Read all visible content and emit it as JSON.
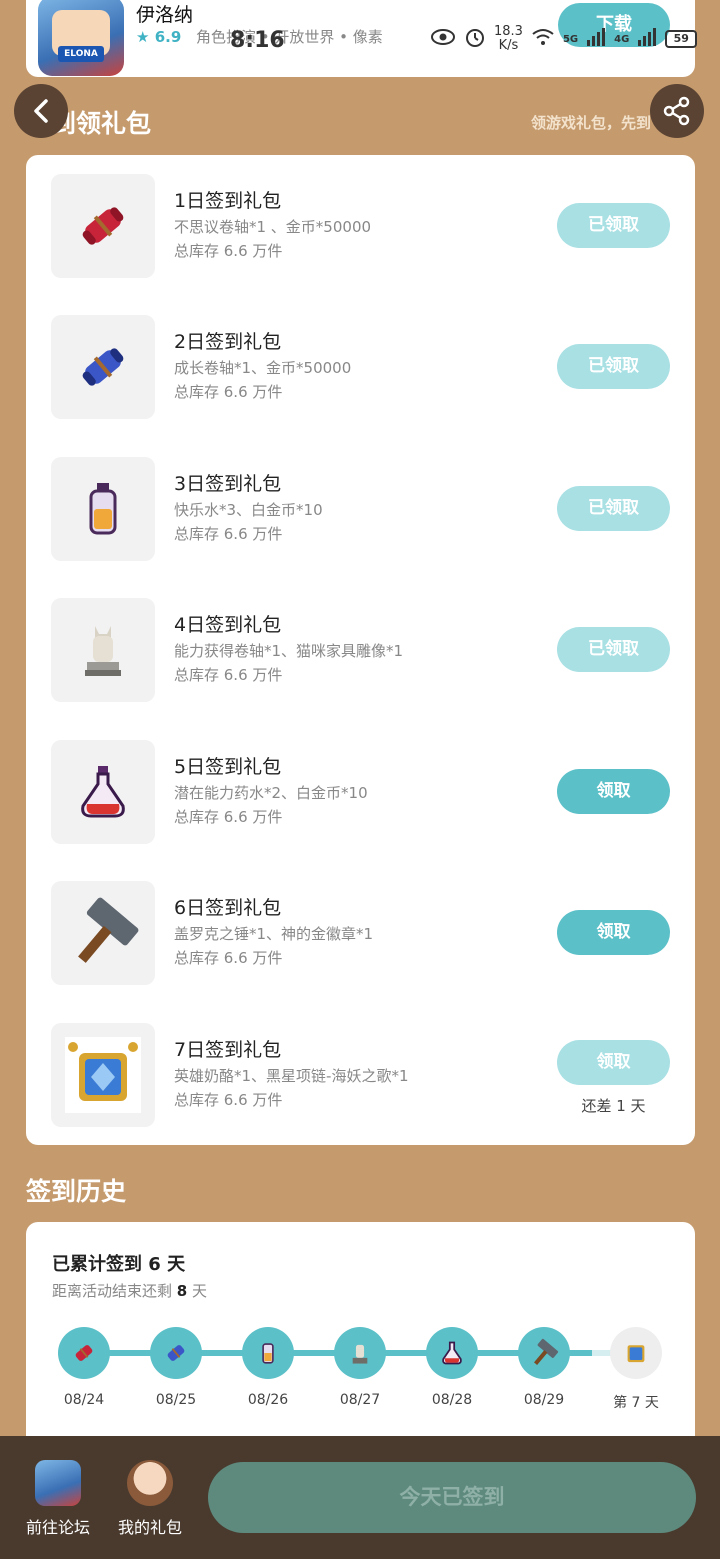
{
  "status_bar": {
    "time": "8:16",
    "net_speed": "18.3",
    "net_unit": "K/s",
    "network_1": "5G",
    "network_2": "4G",
    "battery": "59"
  },
  "game": {
    "name": "伊洛纳",
    "rating": "6.9",
    "tags": "角色扮演 • 开放世界 • 像素",
    "download_label": "下载",
    "icon_text": "ELONA"
  },
  "header": {
    "title": "签到领礼包",
    "subtitle": "领游戏礼包，先到"
  },
  "gifts": [
    {
      "title": "1日签到礼包",
      "desc": "不思议卷轴*1 、金币*50000",
      "stock": "总库存 6.6 万件",
      "button": "已领取",
      "icon": "red-scroll-icon"
    },
    {
      "title": "2日签到礼包",
      "desc": "成长卷轴*1、金币*50000",
      "stock": "总库存 6.6 万件",
      "button": "已领取",
      "icon": "blue-scroll-icon"
    },
    {
      "title": "3日签到礼包",
      "desc": "快乐水*3、白金币*10",
      "stock": "总库存 6.6 万件",
      "button": "已领取",
      "icon": "potion-bottle-icon"
    },
    {
      "title": "4日签到礼包",
      "desc": "能力获得卷轴*1、猫咪家具雕像*1",
      "stock": "总库存 6.6 万件",
      "button": "已领取",
      "icon": "cat-statue-icon"
    },
    {
      "title": "5日签到礼包",
      "desc": "潜在能力药水*2、白金币*10",
      "stock": "总库存 6.6 万件",
      "button": "领取",
      "icon": "flask-icon"
    },
    {
      "title": "6日签到礼包",
      "desc": "盖罗克之锤*1、神的金徽章*1",
      "stock": "总库存 6.6 万件",
      "button": "领取",
      "icon": "hammer-icon"
    },
    {
      "title": "7日签到礼包",
      "desc": "英雄奶酪*1、黑星项链-海妖之歌*1",
      "stock": "总库存 6.6 万件",
      "button": "领取",
      "note": "还差 1 天",
      "icon": "amulet-icon"
    }
  ],
  "history": {
    "title": "签到历史",
    "total_prefix": "已累计签到 ",
    "total_days": "6",
    "total_suffix": " 天",
    "remain_prefix": "距离活动结束还剩 ",
    "remain_days": "8",
    "remain_suffix": " 天",
    "dates": [
      "08/24",
      "08/25",
      "08/26",
      "08/27",
      "08/28",
      "08/29",
      "第 7 天"
    ]
  },
  "bottom": {
    "forum_label": "前往论坛",
    "gift_label": "我的礼包",
    "checkin_label": "今天已签到"
  },
  "colors": {
    "background": "#c59a6d",
    "accent": "#5bc0c8",
    "accent_light": "#a8e0e4",
    "bottom_bar": "#4a3a2e",
    "checkin_btn": "#5e8a7e"
  }
}
